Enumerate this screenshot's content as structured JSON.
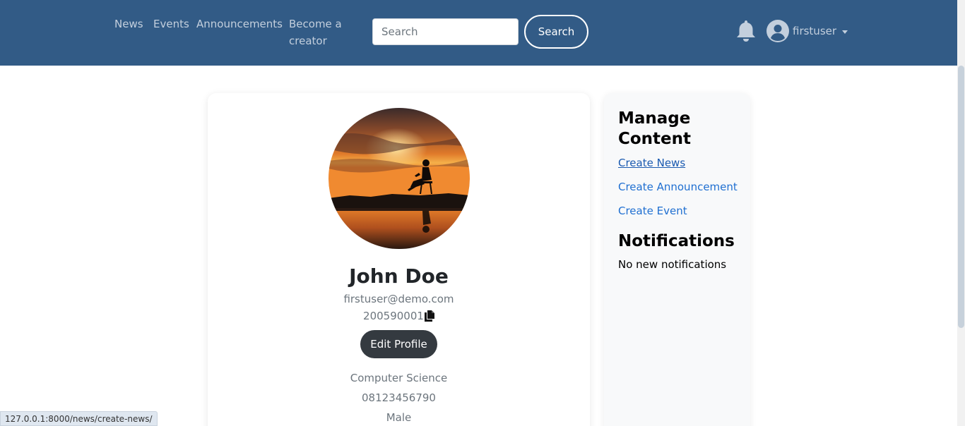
{
  "nav": {
    "links": [
      "News",
      "Events",
      "Announcements",
      "Become a creator"
    ],
    "search_placeholder": "Search",
    "search_button": "Search",
    "username": "firstuser"
  },
  "profile": {
    "name": "John Doe",
    "email": "firstuser@demo.com",
    "id_number": "200590001",
    "edit_button": "Edit Profile",
    "department": "Computer Science",
    "phone": "08123456790",
    "gender": "Male"
  },
  "sidebar": {
    "manage_heading": "Manage Content",
    "links": [
      "Create News",
      "Create Announcement",
      "Create Event"
    ],
    "notifications_heading": "Notifications",
    "notifications_text": "No new notifications"
  },
  "status_url": "127.0.0.1:8000/news/create-news/",
  "icons": {
    "notifications": "bell-icon",
    "user": "user-circle-icon",
    "copy": "copy-icon"
  },
  "colors": {
    "navbar": "#325b86",
    "link": "#1f6fd1",
    "button_dark": "#343a40"
  }
}
